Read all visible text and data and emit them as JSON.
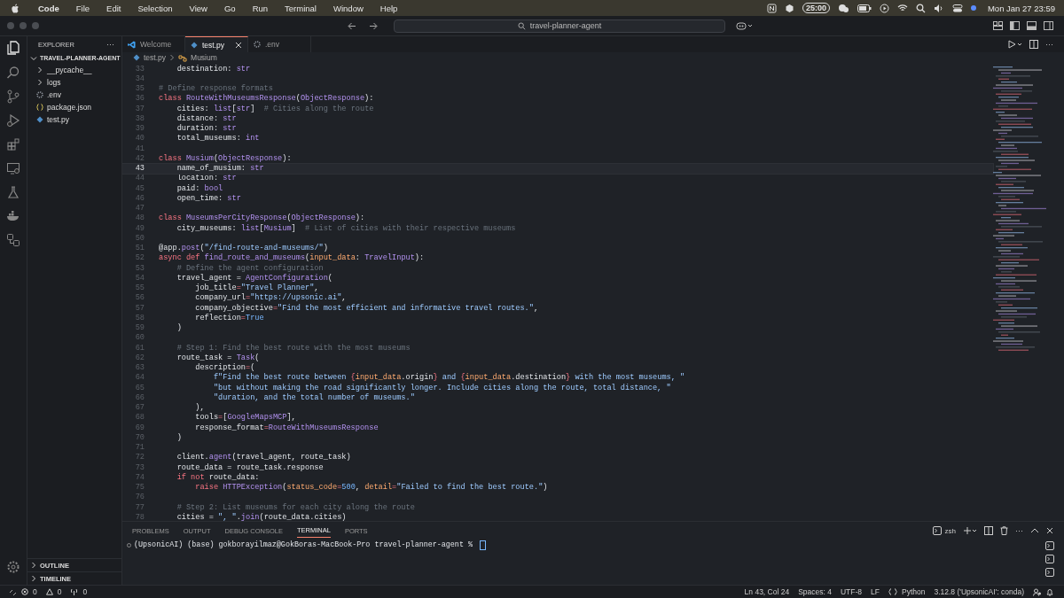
{
  "menu_bar": {
    "items": [
      "Code",
      "File",
      "Edit",
      "Selection",
      "View",
      "Go",
      "Run",
      "Terminal",
      "Window",
      "Help"
    ],
    "timer": "25:00",
    "clock": "Mon Jan 27  23:59"
  },
  "title_bar": {
    "search": "travel-planner-agent"
  },
  "sidebar": {
    "title": "EXPLORER",
    "more": "···",
    "root": {
      "label": "TRAVEL-PLANNER-AGENT",
      "expanded": true,
      "children": [
        {
          "label": "__pycache__",
          "kind": "folder",
          "expanded": false
        },
        {
          "label": "logs",
          "kind": "folder",
          "expanded": false
        },
        {
          "label": ".env",
          "kind": "settings"
        },
        {
          "label": "package.json",
          "kind": "json"
        },
        {
          "label": "test.py",
          "kind": "python"
        }
      ]
    },
    "sections": [
      {
        "label": "OUTLINE",
        "expanded": false
      },
      {
        "label": "TIMELINE",
        "expanded": false
      }
    ]
  },
  "tabs": [
    {
      "label": "Welcome",
      "kind": "welcome",
      "selected": false
    },
    {
      "label": "test.py",
      "kind": "python",
      "selected": true
    },
    {
      "label": ".env",
      "kind": "settings",
      "selected": false
    }
  ],
  "breadcrumb": [
    "test.py",
    "Musium"
  ],
  "code": [
    {
      "number": "33",
      "current": false,
      "tokens": [
        {
          "kind": "n",
          "text": "    destination: "
        },
        {
          "kind": "t",
          "text": "str"
        }
      ]
    },
    {
      "number": "34",
      "current": false
    },
    {
      "number": "35",
      "current": false,
      "tokens": [
        {
          "kind": "m",
          "text": "# Define response formats"
        }
      ]
    },
    {
      "number": "36",
      "current": false,
      "tokens": [
        {
          "kind": "k",
          "text": "class "
        },
        {
          "kind": "c",
          "text": "RouteWithMuseumsResponse"
        },
        {
          "kind": "n",
          "text": "("
        },
        {
          "kind": "c",
          "text": "ObjectResponse"
        },
        {
          "kind": "n",
          "text": "):"
        }
      ]
    },
    {
      "number": "37",
      "current": false,
      "tokens": [
        {
          "kind": "n",
          "text": "    cities: "
        },
        {
          "kind": "t",
          "text": "list"
        },
        {
          "kind": "n",
          "text": "["
        },
        {
          "kind": "t",
          "text": "str"
        },
        {
          "kind": "n",
          "text": "]"
        },
        {
          "kind": "m",
          "text": "  # Cities along the route"
        }
      ]
    },
    {
      "number": "38",
      "current": false,
      "tokens": [
        {
          "kind": "n",
          "text": "    distance: "
        },
        {
          "kind": "t",
          "text": "str"
        }
      ]
    },
    {
      "number": "39",
      "current": false,
      "tokens": [
        {
          "kind": "n",
          "text": "    duration: "
        },
        {
          "kind": "t",
          "text": "str"
        }
      ]
    },
    {
      "number": "40",
      "current": false,
      "tokens": [
        {
          "kind": "n",
          "text": "    total_museums: "
        },
        {
          "kind": "t",
          "text": "int"
        }
      ]
    },
    {
      "number": "41",
      "current": false
    },
    {
      "number": "42",
      "current": false,
      "tokens": [
        {
          "kind": "k",
          "text": "class "
        },
        {
          "kind": "c",
          "text": "Musium"
        },
        {
          "kind": "n",
          "text": "("
        },
        {
          "kind": "c",
          "text": "ObjectResponse"
        },
        {
          "kind": "n",
          "text": "):"
        }
      ]
    },
    {
      "number": "43",
      "current": true,
      "tokens": [
        {
          "kind": "n",
          "text": "    name_of_musium: "
        },
        {
          "kind": "t",
          "text": "str"
        }
      ]
    },
    {
      "number": "44",
      "current": false,
      "tokens": [
        {
          "kind": "n",
          "text": "    location: "
        },
        {
          "kind": "t",
          "text": "str"
        }
      ]
    },
    {
      "number": "45",
      "current": false,
      "tokens": [
        {
          "kind": "n",
          "text": "    paid: "
        },
        {
          "kind": "t",
          "text": "bool"
        }
      ]
    },
    {
      "number": "46",
      "current": false,
      "tokens": [
        {
          "kind": "n",
          "text": "    open_time: "
        },
        {
          "kind": "t",
          "text": "str"
        }
      ]
    },
    {
      "number": "47",
      "current": false
    },
    {
      "number": "48",
      "current": false,
      "tokens": [
        {
          "kind": "k",
          "text": "class "
        },
        {
          "kind": "c",
          "text": "MuseumsPerCityResponse"
        },
        {
          "kind": "n",
          "text": "("
        },
        {
          "kind": "c",
          "text": "ObjectResponse"
        },
        {
          "kind": "n",
          "text": "):"
        }
      ]
    },
    {
      "number": "49",
      "current": false,
      "tokens": [
        {
          "kind": "n",
          "text": "    city_museums: "
        },
        {
          "kind": "t",
          "text": "list"
        },
        {
          "kind": "n",
          "text": "["
        },
        {
          "kind": "c",
          "text": "Musium"
        },
        {
          "kind": "n",
          "text": "]"
        },
        {
          "kind": "m",
          "text": "  # List of cities with their respective museums"
        }
      ]
    },
    {
      "number": "50",
      "current": false
    },
    {
      "number": "51",
      "current": false,
      "tokens": [
        {
          "kind": "n",
          "text": "@app."
        },
        {
          "kind": "f",
          "text": "post"
        },
        {
          "kind": "n",
          "text": "("
        },
        {
          "kind": "s",
          "text": "\"/find-route-and-museums/\""
        },
        {
          "kind": "n",
          "text": ")"
        }
      ]
    },
    {
      "number": "52",
      "current": false,
      "tokens": [
        {
          "kind": "k",
          "text": "async def "
        },
        {
          "kind": "f",
          "text": "find_route_and_museums"
        },
        {
          "kind": "n",
          "text": "("
        },
        {
          "kind": "p",
          "text": "input_data"
        },
        {
          "kind": "n",
          "text": ": "
        },
        {
          "kind": "c",
          "text": "TravelInput"
        },
        {
          "kind": "n",
          "text": "):"
        }
      ]
    },
    {
      "number": "53",
      "current": false,
      "tokens": [
        {
          "kind": "m",
          "text": "    # Define the agent configuration"
        }
      ]
    },
    {
      "number": "54",
      "current": false,
      "tokens": [
        {
          "kind": "n",
          "text": "    travel_agent = "
        },
        {
          "kind": "c",
          "text": "AgentConfiguration"
        },
        {
          "kind": "n",
          "text": "("
        }
      ]
    },
    {
      "number": "55",
      "current": false,
      "tokens": [
        {
          "kind": "n",
          "text": "        job_title"
        },
        {
          "kind": "o",
          "text": "="
        },
        {
          "kind": "s",
          "text": "\"Travel Planner\""
        },
        {
          "kind": "n",
          "text": ","
        }
      ]
    },
    {
      "number": "56",
      "current": false,
      "tokens": [
        {
          "kind": "n",
          "text": "        company_url"
        },
        {
          "kind": "o",
          "text": "="
        },
        {
          "kind": "s",
          "text": "\"https://upsonic.ai\""
        },
        {
          "kind": "n",
          "text": ","
        }
      ]
    },
    {
      "number": "57",
      "current": false,
      "tokens": [
        {
          "kind": "n",
          "text": "        company_objective"
        },
        {
          "kind": "o",
          "text": "="
        },
        {
          "kind": "s",
          "text": "\"Find the most efficient and informative travel routes.\""
        },
        {
          "kind": "n",
          "text": ","
        }
      ]
    },
    {
      "number": "58",
      "current": false,
      "tokens": [
        {
          "kind": "n",
          "text": "        reflection"
        },
        {
          "kind": "o",
          "text": "="
        },
        {
          "kind": "v",
          "text": "True"
        }
      ]
    },
    {
      "number": "59",
      "current": false,
      "tokens": [
        {
          "kind": "n",
          "text": "    )"
        }
      ]
    },
    {
      "number": "60",
      "current": false
    },
    {
      "number": "61",
      "current": false,
      "tokens": [
        {
          "kind": "m",
          "text": "    # Step 1: Find the best route with the most museums"
        }
      ]
    },
    {
      "number": "62",
      "current": false,
      "tokens": [
        {
          "kind": "n",
          "text": "    route_task = "
        },
        {
          "kind": "c",
          "text": "Task"
        },
        {
          "kind": "n",
          "text": "("
        }
      ]
    },
    {
      "number": "63",
      "current": false,
      "tokens": [
        {
          "kind": "n",
          "text": "        description"
        },
        {
          "kind": "o",
          "text": "="
        },
        {
          "kind": "n",
          "text": "("
        }
      ]
    },
    {
      "number": "64",
      "current": false,
      "tokens": [
        {
          "kind": "s",
          "text": "            f\"Find the best route between "
        },
        {
          "kind": "o",
          "text": "{"
        },
        {
          "kind": "p",
          "text": "input_data"
        },
        {
          "kind": "n",
          "text": ".origin"
        },
        {
          "kind": "o",
          "text": "}"
        },
        {
          "kind": "s",
          "text": " and "
        },
        {
          "kind": "o",
          "text": "{"
        },
        {
          "kind": "p",
          "text": "input_data"
        },
        {
          "kind": "n",
          "text": ".destination"
        },
        {
          "kind": "o",
          "text": "}"
        },
        {
          "kind": "s",
          "text": " with the most museums, \""
        }
      ]
    },
    {
      "number": "65",
      "current": false,
      "tokens": [
        {
          "kind": "s",
          "text": "            \"but without making the road significantly longer. Include cities along the route, total distance, \""
        }
      ]
    },
    {
      "number": "66",
      "current": false,
      "tokens": [
        {
          "kind": "s",
          "text": "            \"duration, and the total number of museums.\""
        }
      ]
    },
    {
      "number": "67",
      "current": false,
      "tokens": [
        {
          "kind": "n",
          "text": "        ),"
        }
      ]
    },
    {
      "number": "68",
      "current": false,
      "tokens": [
        {
          "kind": "n",
          "text": "        tools"
        },
        {
          "kind": "o",
          "text": "="
        },
        {
          "kind": "n",
          "text": "["
        },
        {
          "kind": "c",
          "text": "GoogleMapsMCP"
        },
        {
          "kind": "n",
          "text": "],"
        }
      ]
    },
    {
      "number": "69",
      "current": false,
      "tokens": [
        {
          "kind": "n",
          "text": "        response_format"
        },
        {
          "kind": "o",
          "text": "="
        },
        {
          "kind": "c",
          "text": "RouteWithMuseumsResponse"
        }
      ]
    },
    {
      "number": "70",
      "current": false,
      "tokens": [
        {
          "kind": "n",
          "text": "    )"
        }
      ]
    },
    {
      "number": "71",
      "current": false
    },
    {
      "number": "72",
      "current": false,
      "tokens": [
        {
          "kind": "n",
          "text": "    client."
        },
        {
          "kind": "f",
          "text": "agent"
        },
        {
          "kind": "n",
          "text": "(travel_agent, route_task)"
        }
      ]
    },
    {
      "number": "73",
      "current": false,
      "tokens": [
        {
          "kind": "n",
          "text": "    route_data = route_task.response"
        }
      ]
    },
    {
      "number": "74",
      "current": false,
      "tokens": [
        {
          "kind": "k",
          "text": "    if not "
        },
        {
          "kind": "n",
          "text": "route_data:"
        }
      ]
    },
    {
      "number": "75",
      "current": false,
      "tokens": [
        {
          "kind": "k",
          "text": "        raise "
        },
        {
          "kind": "c",
          "text": "HTTPException"
        },
        {
          "kind": "n",
          "text": "("
        },
        {
          "kind": "p",
          "text": "status_code"
        },
        {
          "kind": "o",
          "text": "="
        },
        {
          "kind": "v",
          "text": "500"
        },
        {
          "kind": "n",
          "text": ", "
        },
        {
          "kind": "p",
          "text": "detail"
        },
        {
          "kind": "o",
          "text": "="
        },
        {
          "kind": "s",
          "text": "\"Failed to find the best route.\""
        },
        {
          "kind": "n",
          "text": ")"
        }
      ]
    },
    {
      "number": "76",
      "current": false
    },
    {
      "number": "77",
      "current": false,
      "tokens": [
        {
          "kind": "m",
          "text": "    # Step 2: List museums for each city along the route"
        }
      ]
    },
    {
      "number": "78",
      "current": false,
      "tokens": [
        {
          "kind": "n",
          "text": "    cities = "
        },
        {
          "kind": "s",
          "text": "\", \""
        },
        {
          "kind": "n",
          "text": "."
        },
        {
          "kind": "f",
          "text": "join"
        },
        {
          "kind": "n",
          "text": "(route_data.cities)"
        }
      ]
    }
  ],
  "panel": {
    "tabs": [
      {
        "label": "PROBLEMS",
        "selected": false
      },
      {
        "label": "OUTPUT",
        "selected": false
      },
      {
        "label": "DEBUG CONSOLE",
        "selected": false
      },
      {
        "label": "TERMINAL",
        "selected": true
      },
      {
        "label": "PORTS",
        "selected": false
      }
    ],
    "shell": "zsh",
    "prompt": "(UpsonicAI) (base) gokborayilmaz@GokBoras-MacBook-Pro travel-planner-agent % "
  },
  "status_bar": {
    "errors": "0",
    "warnings": "0",
    "ports": "0",
    "position": "Ln 43, Col 24",
    "indent": "Spaces: 4",
    "encoding": "UTF-8",
    "eol": "LF",
    "language": "Python",
    "interpreter": "3.12.8 ('UpsonicAI': conda)"
  }
}
